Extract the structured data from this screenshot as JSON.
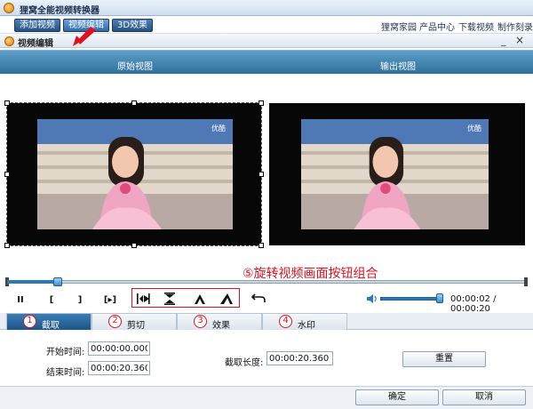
{
  "app": {
    "title": "狸窝全能视频转换器"
  },
  "toolbar": {
    "buttons": [
      {
        "label": "添加视频",
        "active": false
      },
      {
        "label": "视频编辑",
        "active": true
      },
      {
        "label": "3D效果",
        "active": false
      }
    ],
    "links": [
      "狸窝家园",
      "产品中心",
      "下载视频",
      "制作刻录"
    ]
  },
  "dialog": {
    "title": "视频编辑",
    "minimize": "_",
    "close": "×"
  },
  "views": {
    "original": "原始视图",
    "output": "输出视图",
    "watermark": "优酷"
  },
  "controls": {
    "play_pause": "II",
    "mark_in": "[",
    "mark_out": "]",
    "frame_step": "[▸]",
    "rotate_icons": [
      "flip-horizontal-icon",
      "flip-vertical-icon",
      "rotate-left-icon",
      "rotate-right-icon"
    ],
    "undo_icon": "undo-icon",
    "annotation": "⑤旋转视频画面按钮组合",
    "progress": 0.1,
    "volume": 0.95,
    "time": "00:00:02 / 00:00:20"
  },
  "tabs": [
    {
      "num": "1",
      "label": "截取",
      "active": true
    },
    {
      "num": "2",
      "label": "剪切",
      "active": false
    },
    {
      "num": "3",
      "label": "效果",
      "active": false
    },
    {
      "num": "4",
      "label": "水印",
      "active": false
    }
  ],
  "trim": {
    "start_label": "开始时间:",
    "start_value": "00:00:00.000",
    "end_label": "结束时间:",
    "end_value": "00:00:20.360",
    "length_label": "截取长度:",
    "length_value": "00:00:20.360",
    "reset": "重置"
  },
  "footer": {
    "ok": "确定",
    "cancel": "取消"
  },
  "colors": {
    "accent": "#2e6f9c",
    "annotation": "#e0101e"
  }
}
